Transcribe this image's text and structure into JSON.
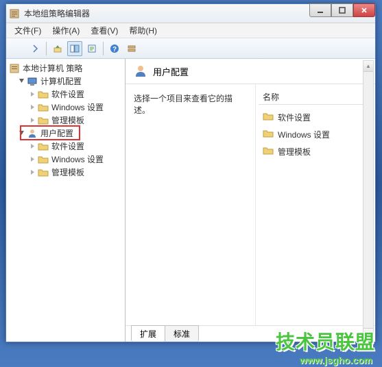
{
  "window": {
    "title": "本地组策略编辑器"
  },
  "menu": {
    "file": "文件(F)",
    "action": "操作(A)",
    "view": "查看(V)",
    "help": "帮助(H)"
  },
  "tree": {
    "root": "本地计算机 策略",
    "computer_config": "计算机配置",
    "user_config": "用户配置",
    "software": "软件设置",
    "windows": "Windows 设置",
    "templates": "管理模板"
  },
  "content": {
    "header": "用户配置",
    "description": "选择一个项目来查看它的描述。",
    "column_name": "名称",
    "items": {
      "software": "软件设置",
      "windows": "Windows 设置",
      "templates": "管理模板"
    }
  },
  "tabs": {
    "extended": "扩展",
    "standard": "标准"
  },
  "watermark": {
    "main": "技术员联盟",
    "sub": "www.jsgho.com"
  }
}
